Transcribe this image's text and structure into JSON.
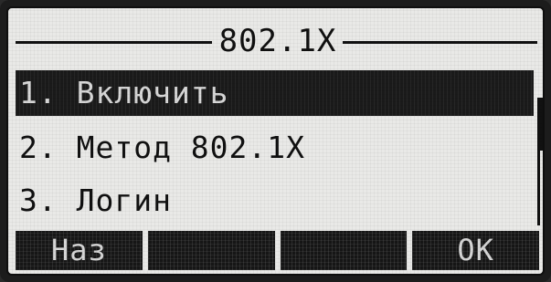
{
  "screen": {
    "title": "802.1X"
  },
  "menu": {
    "items": [
      {
        "label": "1. Включить",
        "selected": true
      },
      {
        "label": "2. Метод 802.1X",
        "selected": false
      },
      {
        "label": "3. Логин",
        "selected": false
      }
    ]
  },
  "softkeys": [
    {
      "label": "Наз"
    },
    {
      "label": ""
    },
    {
      "label": ""
    },
    {
      "label": "OK"
    }
  ],
  "colors": {
    "lcd_background": "#e9e9e7",
    "ink": "#101010",
    "highlight": "#1a1a1a"
  }
}
